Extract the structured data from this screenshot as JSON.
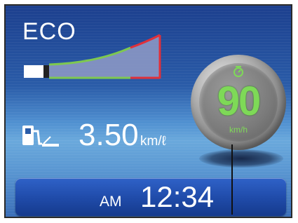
{
  "eco": {
    "label": "ECO",
    "level": 0.15,
    "colors": {
      "green": "#7ec850",
      "red": "#e0303a",
      "fill": "#8b97c4",
      "indicator": "#ffffff"
    }
  },
  "fuel_economy": {
    "icon": "fuel-pump-icon",
    "value": "3.50",
    "unit": "km/ℓ"
  },
  "speed_limit": {
    "icon": "speed-camera-icon",
    "value": "90",
    "unit": "km/h",
    "color": "#7ed957"
  },
  "clock": {
    "ampm": "AM",
    "time": "12:34"
  }
}
